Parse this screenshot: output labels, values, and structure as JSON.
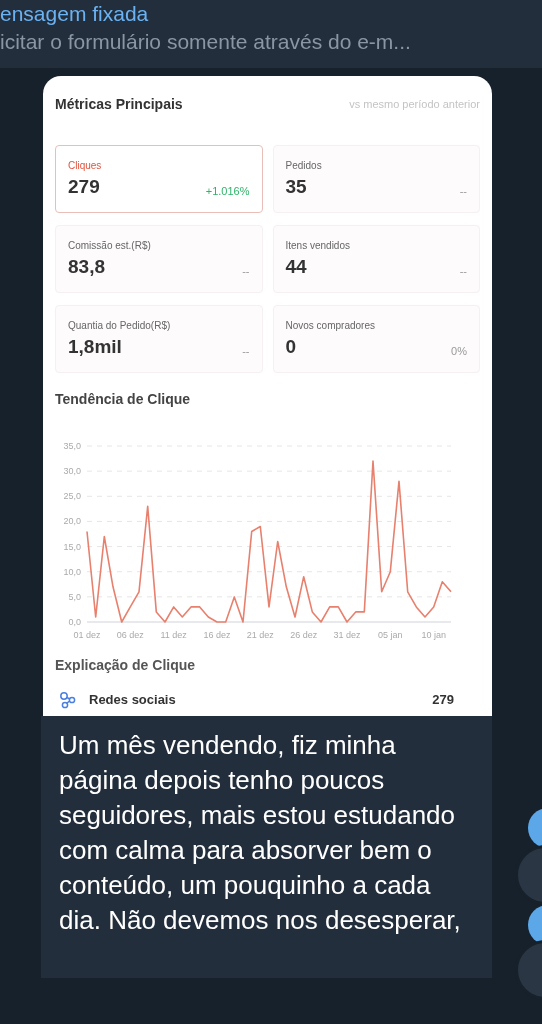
{
  "pinned": {
    "title": "ensagem fixada",
    "text": "icitar o formulário somente através do e-m..."
  },
  "report": {
    "title": "Métricas Principais",
    "comparison": "vs mesmo período anterior",
    "metrics": [
      {
        "label": "Cliques",
        "value": "279",
        "change": "+1.016%",
        "kind": "up",
        "selected": true
      },
      {
        "label": "Pedidos",
        "value": "35",
        "change": "--",
        "kind": "flat",
        "selected": false
      },
      {
        "label": "Comissão est.(R$)",
        "value": "83,8",
        "change": "--",
        "kind": "flat",
        "selected": false
      },
      {
        "label": "Itens vendidos",
        "value": "44",
        "change": "--",
        "kind": "flat",
        "selected": false
      },
      {
        "label": "Quantia do Pedido(R$)",
        "value": "1,8mil",
        "change": "--",
        "kind": "flat",
        "selected": false
      },
      {
        "label": "Novos compradores",
        "value": "0",
        "change": "0%",
        "kind": "flat",
        "selected": false
      }
    ],
    "trend_title": "Tendência de Clique",
    "chart_data": {
      "type": "line",
      "categories": [
        "01 dez",
        null,
        null,
        null,
        null,
        "06 dez",
        null,
        null,
        null,
        null,
        "11 dez",
        null,
        null,
        null,
        null,
        "16 dez",
        null,
        null,
        null,
        null,
        "21 dez",
        null,
        null,
        null,
        null,
        "26 dez",
        null,
        null,
        null,
        null,
        "31 dez",
        null,
        null,
        null,
        null,
        "05 jan",
        null,
        null,
        null,
        null,
        "10 jan",
        null,
        null
      ],
      "series": [
        {
          "color": "#e8806e",
          "values": [
            18,
            1,
            17,
            7,
            0,
            3,
            6,
            23,
            2,
            0,
            3,
            1,
            3,
            3,
            1,
            0,
            0,
            5,
            0,
            18,
            19,
            3,
            16,
            7,
            1,
            9,
            2,
            0,
            3,
            3,
            0,
            2,
            2,
            32,
            6,
            10,
            28,
            6,
            3,
            1,
            3,
            8,
            6
          ]
        }
      ],
      "ylim": [
        0,
        35
      ],
      "grid": true,
      "yticks": [
        {
          "value": 0,
          "label": "0,0"
        },
        {
          "value": 5,
          "label": "5,0"
        },
        {
          "value": 10,
          "label": "10,0"
        },
        {
          "value": 15,
          "label": "15,0"
        },
        {
          "value": 20,
          "label": "20,0"
        },
        {
          "value": 25,
          "label": "25,0"
        },
        {
          "value": 30,
          "label": "30,0"
        },
        {
          "value": 35,
          "label": "35,0"
        }
      ]
    },
    "explain_title": "Explicação de Clique",
    "sources": [
      {
        "name": "Redes sociais",
        "count": "279"
      }
    ]
  },
  "message": {
    "text": "Um mês vendendo, fiz minha página depois tenho poucos seguidores, mais estou estudando com calma para absorver bem o conteúdo, um pouquinho a cada dia. Não devemos nos desesperar,"
  }
}
